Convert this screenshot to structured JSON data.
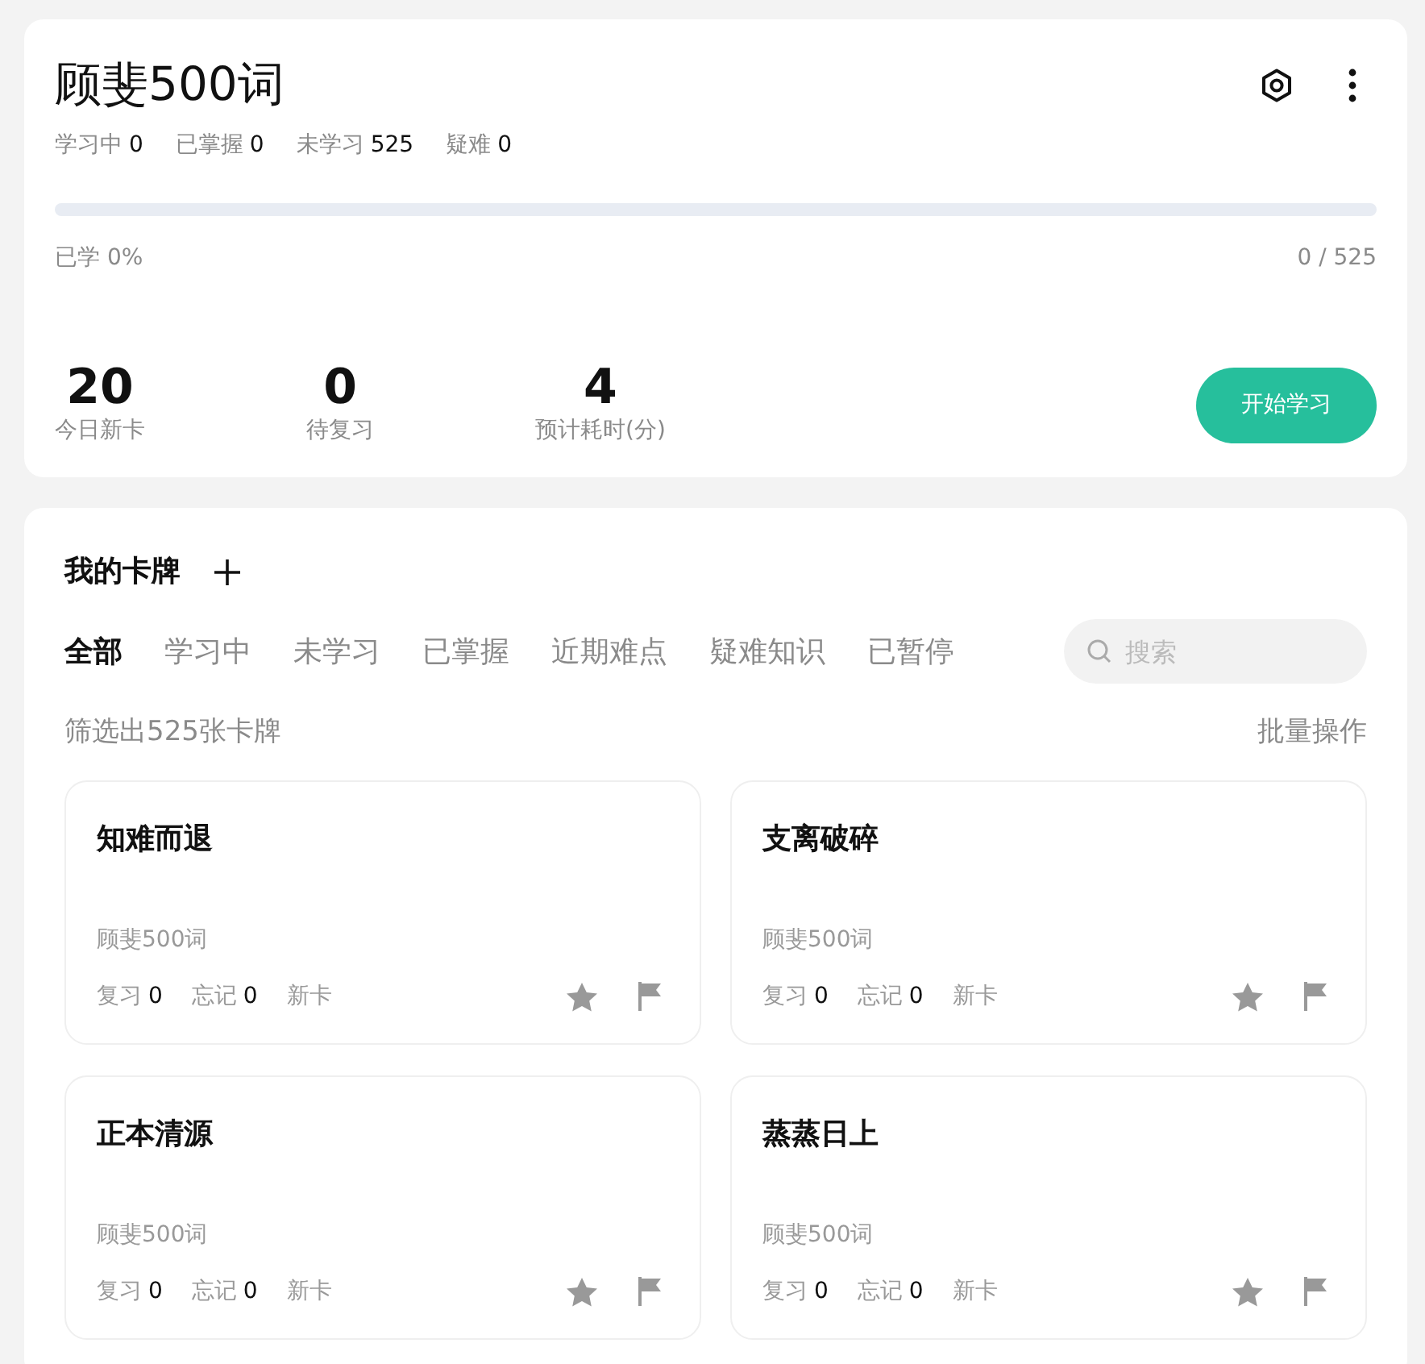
{
  "deck": {
    "title": "顾斐500词",
    "stats": [
      {
        "label": "学习中",
        "value": "0"
      },
      {
        "label": "已掌握",
        "value": "0"
      },
      {
        "label": "未学习",
        "value": "525"
      },
      {
        "label": "疑难",
        "value": "0"
      }
    ],
    "progress": {
      "level": 0,
      "label": "已学 0%",
      "count": "0 / 525"
    },
    "summary": [
      {
        "value": "20",
        "label": "今日新卡"
      },
      {
        "value": "0",
        "label": "待复习"
      },
      {
        "value": "4",
        "label": "预计耗时(分)"
      }
    ],
    "start_button": "开始学习"
  },
  "cards_panel": {
    "title": "我的卡牌",
    "tabs": [
      {
        "label": "全部",
        "selected": true
      },
      {
        "label": "学习中",
        "selected": false
      },
      {
        "label": "未学习",
        "selected": false
      },
      {
        "label": "已掌握",
        "selected": false
      },
      {
        "label": "近期难点",
        "selected": false
      },
      {
        "label": "疑难知识",
        "selected": false
      },
      {
        "label": "已暂停",
        "selected": false
      }
    ],
    "search": {
      "placeholder": "搜索"
    },
    "filter_count": "筛选出525张卡牌",
    "batch_action": "批量操作",
    "cards": [
      {
        "title": "知难而退",
        "deck": "顾斐500词",
        "counts": [
          {
            "label": "复习",
            "value": "0"
          },
          {
            "label": "忘记",
            "value": "0"
          }
        ],
        "status": "新卡",
        "starred": false,
        "flagged": false
      },
      {
        "title": "支离破碎",
        "deck": "顾斐500词",
        "counts": [
          {
            "label": "复习",
            "value": "0"
          },
          {
            "label": "忘记",
            "value": "0"
          }
        ],
        "status": "新卡",
        "starred": false,
        "flagged": false
      },
      {
        "title": "正本清源",
        "deck": "顾斐500词",
        "counts": [
          {
            "label": "复习",
            "value": "0"
          },
          {
            "label": "忘记",
            "value": "0"
          }
        ],
        "status": "新卡",
        "starred": false,
        "flagged": false
      },
      {
        "title": "蒸蒸日上",
        "deck": "顾斐500词",
        "counts": [
          {
            "label": "复习",
            "value": "0"
          },
          {
            "label": "忘记",
            "value": "0"
          }
        ],
        "status": "新卡",
        "starred": false,
        "flagged": false
      }
    ]
  }
}
